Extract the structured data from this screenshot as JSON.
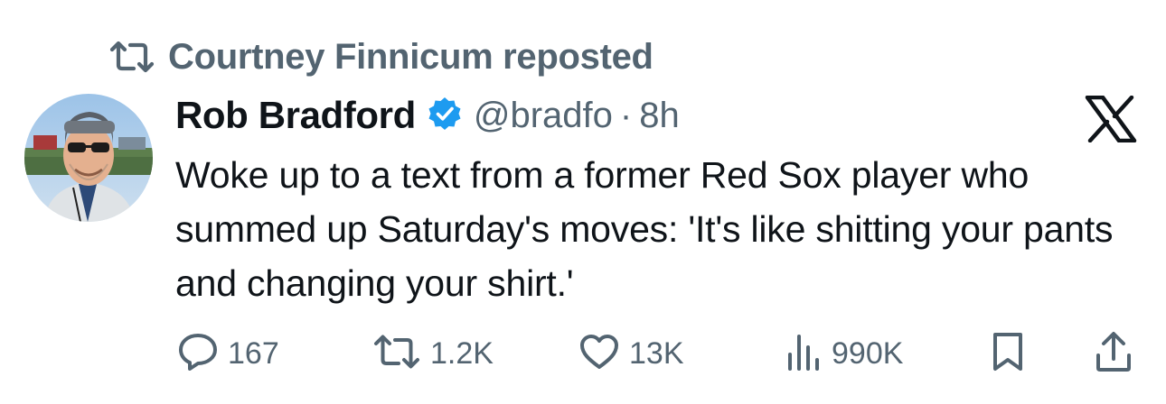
{
  "repost_banner": {
    "text": "Courtney Finnicum reposted",
    "icon": "repost-icon"
  },
  "author": {
    "name": "Rob Bradford",
    "handle": "@bradfo",
    "separator": "·",
    "time": "8h",
    "verified": true,
    "verified_color": "#1d9bf0",
    "avatar_icon": "avatar-photo"
  },
  "platform_logo": "x-logo-icon",
  "tweet": {
    "text": "Woke up to a text from a former Red Sox player who summed up Saturday's moves: 'It's like shitting your pants and changing your shirt.'"
  },
  "actions": {
    "replies": "167",
    "reposts": "1.2K",
    "likes": "13K",
    "views": "990K",
    "bookmark_icon": "bookmark-icon",
    "share_icon": "share-icon"
  },
  "colors": {
    "text_primary": "#0f1419",
    "text_secondary": "#536471",
    "background": "#ffffff"
  }
}
